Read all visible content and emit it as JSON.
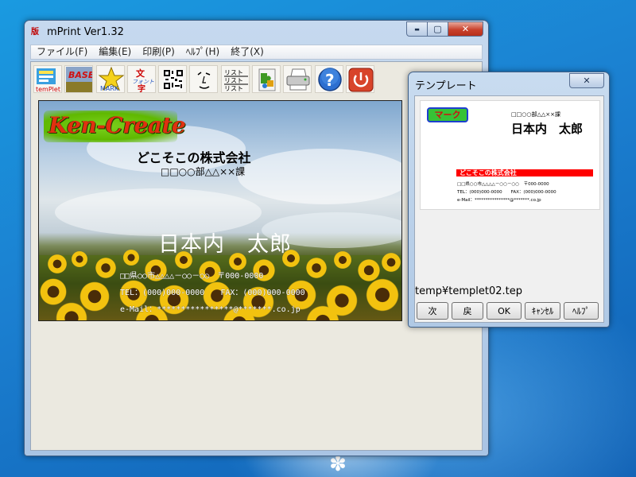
{
  "main_window": {
    "app_icon": "版",
    "title": "mPrint Ver1.32",
    "caption_buttons": {
      "minimize": "▬",
      "maximize": "▢",
      "close": "✕"
    }
  },
  "menu": [
    "ファイル(F)",
    "編集(E)",
    "印刷(P)",
    "ﾍﾙﾌﾟ(H)",
    "終了(X)"
  ],
  "toolbar": {
    "buttons": [
      {
        "name": "template-icon",
        "label": "temPlet"
      },
      {
        "name": "base-icon",
        "label": "BASE"
      },
      {
        "name": "mark-icon",
        "label": "MARK"
      },
      {
        "name": "font-text-icon",
        "label": "文フォント字"
      },
      {
        "name": "qr-code-icon",
        "label": ""
      },
      {
        "name": "face-drawing-icon",
        "label": ""
      },
      {
        "name": "list-icon",
        "label": "リストリストリスト"
      },
      {
        "name": "puzzle-icon",
        "label": ""
      },
      {
        "name": "printer-icon",
        "label": ""
      },
      {
        "name": "help-icon",
        "label": "?"
      },
      {
        "name": "power-icon",
        "label": ""
      }
    ]
  },
  "card": {
    "logo": "Ken-Create",
    "company": "どこそこの株式会社",
    "department": "□□○○部△△××課",
    "person_name": "日本内　太郎",
    "address": "□□県○○市△△△△－○○－○○　〒000-0000",
    "phone_fax": "TEL：(000)000-0000　　FAX：(000)000-0000",
    "email": "e-Mail：****************@*******.co.jp"
  },
  "template_dialog": {
    "title": "テンプレート",
    "close": "✕",
    "preview": {
      "mark_label": "マーク",
      "department": "□□○○部△△××課",
      "person_name": "日本内　太郎",
      "company": "どこそこの株式会社",
      "address": "□□県○○市△△△△－○○－○○　〒000-0000",
      "phone_fax": "TEL：(000)000-0000　　FAX：(000)000-0000",
      "email": "e-Mail：****************@*******.co.jp"
    },
    "file_path": "temp¥templet02.tep",
    "buttons": {
      "next": "次",
      "back": "戻",
      "ok": "OK",
      "cancel": "ｷｬﾝｾﾙ",
      "help": "ﾍﾙﾌﾟ"
    }
  },
  "colors": {
    "desktop": "#1b7fd0",
    "title_gradient": "#c6d9ef",
    "close_button": "#c9412c",
    "logo_red": "#e03010",
    "logo_green": "#5fb800",
    "template_company_bar": "#ff0000"
  }
}
